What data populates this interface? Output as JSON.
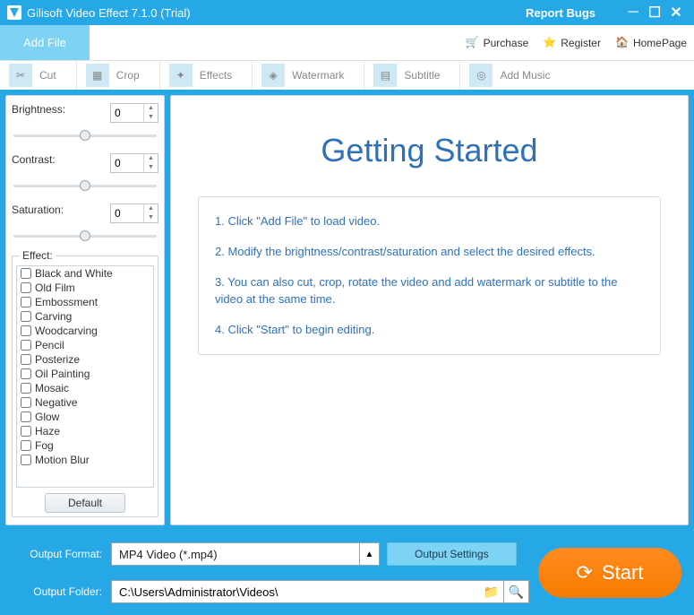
{
  "header": {
    "title": "Gilisoft Video Effect 7.1.0 (Trial)",
    "report_bugs": "Report Bugs"
  },
  "toolbar": {
    "add_file": "Add File",
    "purchase": "Purchase",
    "register": "Register",
    "homepage": "HomePage"
  },
  "tabs": {
    "cut": "Cut",
    "crop": "Crop",
    "effects": "Effects",
    "watermark": "Watermark",
    "subtitle": "Subtitle",
    "add_music": "Add Music"
  },
  "sidebar": {
    "brightness_label": "Brightness:",
    "brightness_value": "0",
    "contrast_label": "Contrast:",
    "contrast_value": "0",
    "saturation_label": "Saturation:",
    "saturation_value": "0",
    "effect_label": "Effect:",
    "default_button": "Default",
    "effects": [
      "Black and White",
      "Old Film",
      "Embossment",
      "Carving",
      "Woodcarving",
      "Pencil",
      "Posterize",
      "Oil Painting",
      "Mosaic",
      "Negative",
      "Glow",
      "Haze",
      "Fog",
      "Motion Blur"
    ]
  },
  "main": {
    "heading": "Getting Started",
    "step1": "1. Click \"Add File\" to load video.",
    "step2": "2. Modify the brightness/contrast/saturation and select the desired effects.",
    "step3": "3. You can also cut, crop, rotate the video and add watermark or subtitle to the video at the same time.",
    "step4": "4. Click \"Start\" to begin editing."
  },
  "bottom": {
    "output_format_label": "Output Format:",
    "output_format_value": "MP4 Video (*.mp4)",
    "output_settings": "Output Settings",
    "output_folder_label": "Output Folder:",
    "output_folder_value": "C:\\Users\\Administrator\\Videos\\",
    "start": "Start"
  }
}
